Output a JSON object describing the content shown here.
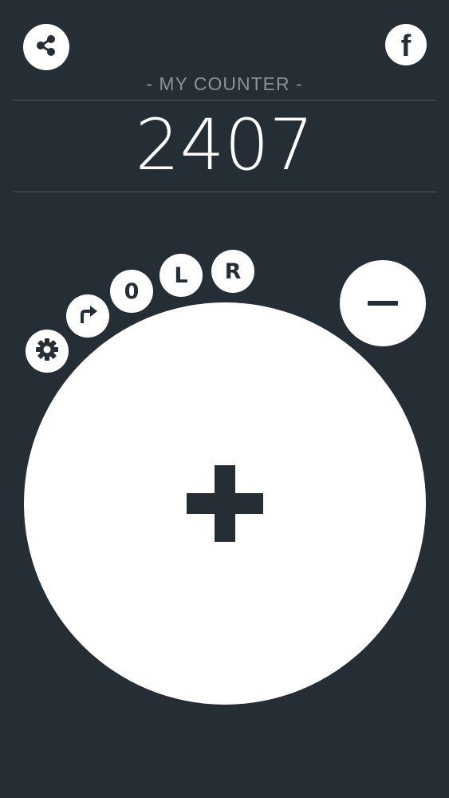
{
  "header": {
    "share_icon": "share-icon",
    "facebook_icon": "facebook-icon",
    "facebook_letter": "f"
  },
  "counter": {
    "title": "- MY COUNTER -",
    "value": "2407"
  },
  "controls": {
    "settings_icon": "gear-icon",
    "redo_icon": "redo-arrow-icon",
    "zero_label": "0",
    "l_label": "L",
    "r_label": "R",
    "minus_icon": "minus-icon",
    "plus_icon": "plus-icon"
  },
  "colors": {
    "background": "#252d35",
    "button": "#ffffff",
    "title": "#8a939c",
    "divider": "#4e5760"
  }
}
